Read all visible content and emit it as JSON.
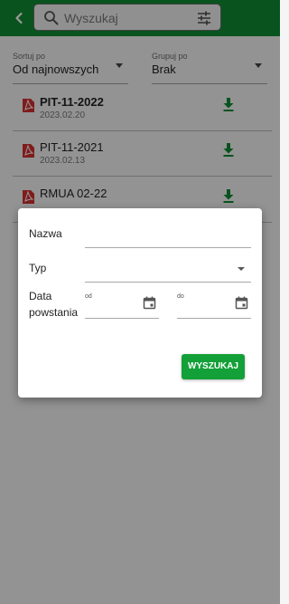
{
  "header": {
    "search_placeholder": "Wyszukaj"
  },
  "filters": {
    "sort": {
      "label": "Sortuj po",
      "value": "Od najnowszych"
    },
    "group": {
      "label": "Grupuj po",
      "value": "Brak"
    }
  },
  "documents": [
    {
      "name": "PIT-11-2022",
      "date": "2023.02.20"
    },
    {
      "name": "PIT-11-2021",
      "date": "2023.02.13"
    },
    {
      "name": "RMUA 02-22",
      "date": ""
    }
  ],
  "dialog": {
    "name_label": "Nazwa",
    "name_value": "",
    "type_label": "Typ",
    "type_value": "",
    "date_label": "Data powstania",
    "from_label": "od",
    "to_label": "do",
    "search_button": "WYSZUKAJ"
  },
  "colors": {
    "brand_green": "#0f8a32",
    "button_green": "#13a038",
    "pdf_red": "#d32f2f"
  }
}
